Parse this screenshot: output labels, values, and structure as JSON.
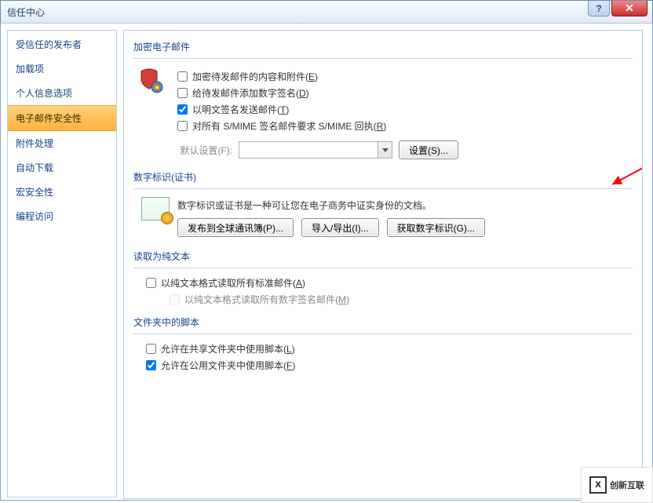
{
  "window": {
    "title": "信任中心"
  },
  "sidebar": {
    "items": [
      {
        "label": "受信任的发布者"
      },
      {
        "label": "加载项"
      },
      {
        "label": "个人信息选项"
      },
      {
        "label": "电子邮件安全性"
      },
      {
        "label": "附件处理"
      },
      {
        "label": "自动下载"
      },
      {
        "label": "宏安全性"
      },
      {
        "label": "编程访问"
      }
    ],
    "selected_index": 3
  },
  "sections": {
    "encrypted_mail": {
      "title": "加密电子邮件",
      "options": [
        {
          "label": "加密待发邮件的内容和附件(",
          "ak": "E",
          "checked": false
        },
        {
          "label": "给待发邮件添加数字签名(",
          "ak": "D",
          "checked": false
        },
        {
          "label": "以明文签名发送邮件(",
          "ak": "T",
          "checked": true
        },
        {
          "label": "对所有 S/MIME 签名邮件要求 S/MIME 回执(",
          "ak": "R",
          "checked": false
        }
      ],
      "default_label": "默认设置(F):",
      "default_value": "",
      "settings_button": "设置(S)..."
    },
    "digital_id": {
      "title": "数字标识(证书)",
      "description": "数字标识或证书是一种可让您在电子商务中证实身份的文档。",
      "buttons": {
        "publish": "发布到全球通讯簿(P)...",
        "import_export": "导入/导出(I)...",
        "get_id": "获取数字标识(G)..."
      }
    },
    "plain_text": {
      "title": "读取为纯文本",
      "options": [
        {
          "label": "以纯文本格式读取所有标准邮件(",
          "ak": "A",
          "checked": false,
          "enabled": true
        },
        {
          "label": "以纯文本格式读取所有数字签名邮件(",
          "ak": "M",
          "checked": false,
          "enabled": false
        }
      ]
    },
    "folder_scripts": {
      "title": "文件夹中的脚本",
      "options": [
        {
          "label": "允许在共享文件夹中使用脚本(",
          "ak": "L",
          "checked": false
        },
        {
          "label": "允许在公用文件夹中使用脚本(",
          "ak": "F",
          "checked": true
        }
      ]
    }
  },
  "watermark": {
    "logo": "X",
    "text": "创新互联"
  }
}
